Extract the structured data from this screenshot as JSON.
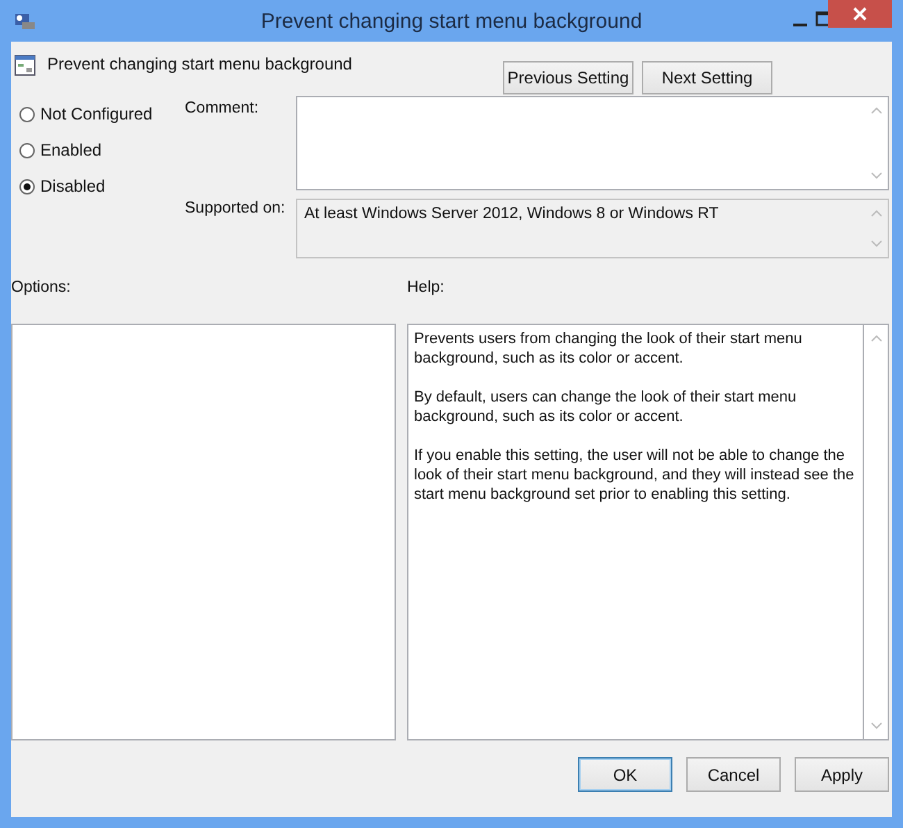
{
  "window": {
    "title": "Prevent changing start menu background"
  },
  "setting": {
    "name": "Prevent changing start menu background"
  },
  "nav_buttons": [
    "Previous Setting",
    "Next Setting"
  ],
  "states": [
    {
      "label": "Not Configured",
      "selected": false
    },
    {
      "label": "Enabled",
      "selected": false
    },
    {
      "label": "Disabled",
      "selected": true
    }
  ],
  "comment": {
    "label": "Comment:"
  },
  "supported_on": {
    "label": "Supported on:",
    "value": "At least Windows Server 2012, Windows 8 or Windows RT"
  },
  "options": {
    "label": "Options:"
  },
  "help": {
    "label": "Help:",
    "paragraphs": [
      "Prevents users from changing the look of their start menu background, such as its color or accent.",
      "By default, users can change the look of their start menu background, such as its color or accent.",
      "If you enable this setting, the user will not be able to change the look of their start menu background, and they will instead see the start menu background set prior to enabling this setting."
    ]
  },
  "buttons": [
    "OK",
    "Cancel",
    "Apply"
  ]
}
